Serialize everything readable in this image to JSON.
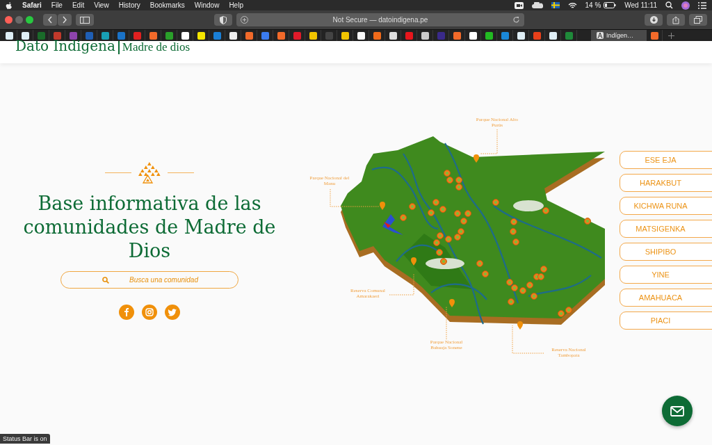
{
  "menubar": {
    "app": "Safari",
    "items": [
      "File",
      "Edit",
      "View",
      "History",
      "Bookmarks",
      "Window",
      "Help"
    ],
    "battery": "14 %",
    "clock": "Wed 11:11"
  },
  "toolbar": {
    "address": "Not Secure — datoindigena.pe"
  },
  "bookmarks": [
    {
      "color": "#dfeef5"
    },
    {
      "color": "#dfeef5"
    },
    {
      "color": "#1a6b2a"
    },
    {
      "color": "#c0392b"
    },
    {
      "color": "#8e44ad"
    },
    {
      "color": "#1f5fb5"
    },
    {
      "color": "#18a0b5"
    },
    {
      "color": "#1a73c8"
    },
    {
      "color": "#e02020"
    },
    {
      "color": "#f26a2a"
    },
    {
      "color": "#2aa02a"
    },
    {
      "color": "#ffffff"
    },
    {
      "color": "#f5e600"
    },
    {
      "color": "#1a7fd6"
    },
    {
      "color": "#eeeeee"
    },
    {
      "color": "#f26a2a"
    },
    {
      "color": "#3b7cf0"
    },
    {
      "color": "#f26a2a"
    },
    {
      "color": "#e01a2a"
    },
    {
      "color": "#f2c500"
    },
    {
      "color": "#444444"
    },
    {
      "color": "#f2c500"
    },
    {
      "color": "#fafafa"
    },
    {
      "color": "#f06a1a"
    },
    {
      "color": "#dddddd"
    },
    {
      "color": "#e8161c"
    },
    {
      "color": "#cccccc"
    },
    {
      "color": "#3a2a8a"
    },
    {
      "color": "#f26a2a"
    },
    {
      "color": "#ffffff"
    },
    {
      "color": "#22bb22"
    },
    {
      "color": "#1a88d8"
    },
    {
      "color": "#dfeef5"
    },
    {
      "color": "#e8401a"
    },
    {
      "color": "#dfeef5"
    },
    {
      "color": "#1f8a3a"
    }
  ],
  "tab": {
    "title": "Indígen…",
    "selected": true
  },
  "bookmarks_after_tab": [
    {
      "color": "#f26a2a"
    }
  ],
  "site": {
    "logo_title": "Dato Indigena",
    "logo_subtitle": "Madre de dios",
    "heading": "Base informativa de las comunidades de Madre de Dios",
    "search": {
      "placeholder": "Busca una comunidad"
    },
    "social": [
      {
        "kind": "facebook"
      },
      {
        "kind": "instagram"
      },
      {
        "kind": "twitter"
      }
    ],
    "map_labels": [
      "Parque Nacional Alto Purús",
      "Parque Nacional del Manu",
      "Reserva Comunal Amarakaeri",
      "Parque Nacional Bahuaja Sonene",
      "Reserva Nacional Tambopata"
    ],
    "communities": [
      "ESE EJA",
      "HARAKBUT",
      "KICHWA RUNA",
      "MATSIGENKA",
      "SHIPIBO",
      "YINE",
      "AMAHUACA",
      "PIACI"
    ]
  },
  "status_bar": "Status Bar is on"
}
